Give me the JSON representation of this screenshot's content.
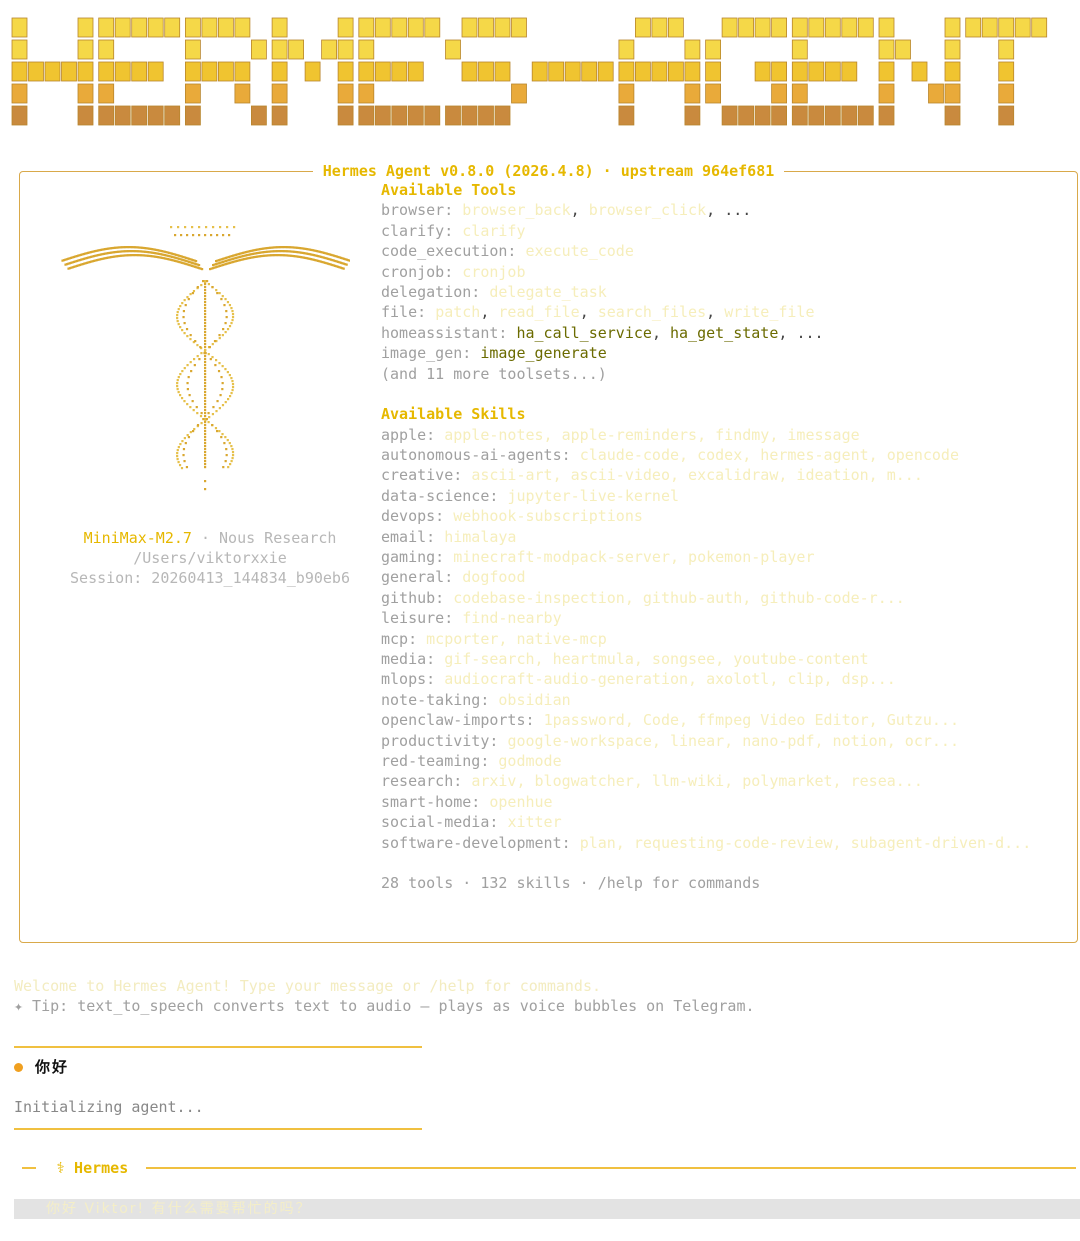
{
  "banner": {
    "text": "HERMES-AGENT",
    "colors": [
      "#f5d848",
      "#f0c430",
      "#e9aa3a",
      "#c98a3e"
    ]
  },
  "panel": {
    "title": "Hermes Agent v0.8.0 (2026.4.8) · upstream 964ef681",
    "border_color": "#d9a94a",
    "left": {
      "logo_icon": "caduceus-ascii-icon",
      "model": "MiniMax-M2.7",
      "provider": " · Nous Research",
      "path": "/Users/viktorxxie",
      "session": "Session: 20260413_144834_b90eb6"
    },
    "tools": {
      "heading": "Available Tools",
      "rows": [
        {
          "key": "browser: ",
          "value": "browser_back, browser_click, ..."
        },
        {
          "key": "clarify: ",
          "value": "clarify"
        },
        {
          "key": "code_execution: ",
          "value": "execute_code"
        },
        {
          "key": "cronjob: ",
          "value": "cronjob"
        },
        {
          "key": "delegation: ",
          "value": "delegate_task"
        },
        {
          "key": "file: ",
          "value": "patch, read_file, search_files, write_file"
        },
        {
          "key": "homeassistant: ",
          "value": "ha_call_service, ha_get_state, ..."
        },
        {
          "key": "image_gen: ",
          "value": "image_generate"
        }
      ],
      "more": "(and 11 more toolsets...)"
    },
    "skills": {
      "heading": "Available Skills",
      "rows": [
        {
          "key": "apple: ",
          "value": "apple-notes, apple-reminders, findmy, imessage"
        },
        {
          "key": "autonomous-ai-agents: ",
          "value": "claude-code, codex, hermes-agent, opencode"
        },
        {
          "key": "creative: ",
          "value": "ascii-art, ascii-video, excalidraw, ideation, m..."
        },
        {
          "key": "data-science: ",
          "value": "jupyter-live-kernel"
        },
        {
          "key": "devops: ",
          "value": "webhook-subscriptions"
        },
        {
          "key": "email: ",
          "value": "himalaya"
        },
        {
          "key": "gaming: ",
          "value": "minecraft-modpack-server, pokemon-player"
        },
        {
          "key": "general: ",
          "value": "dogfood"
        },
        {
          "key": "github: ",
          "value": "codebase-inspection, github-auth, github-code-r..."
        },
        {
          "key": "leisure: ",
          "value": "find-nearby"
        },
        {
          "key": "mcp: ",
          "value": "mcporter, native-mcp"
        },
        {
          "key": "media: ",
          "value": "gif-search, heartmula, songsee, youtube-content"
        },
        {
          "key": "mlops: ",
          "value": "audiocraft-audio-generation, axolotl, clip, dsp..."
        },
        {
          "key": "note-taking: ",
          "value": "obsidian"
        },
        {
          "key": "openclaw-imports: ",
          "value": "1password, Code, ffmpeg Video Editor, Gutzu..."
        },
        {
          "key": "productivity: ",
          "value": "google-workspace, linear, nano-pdf, notion, ocr..."
        },
        {
          "key": "red-teaming: ",
          "value": "godmode"
        },
        {
          "key": "research: ",
          "value": "arxiv, blogwatcher, llm-wiki, polymarket, resea..."
        },
        {
          "key": "smart-home: ",
          "value": "openhue"
        },
        {
          "key": "social-media: ",
          "value": "xitter"
        },
        {
          "key": "software-development: ",
          "value": "plan, requesting-code-review, subagent-driven-d..."
        }
      ]
    },
    "footer": "28 tools · 132 skills · /help for commands"
  },
  "welcome": "Welcome to Hermes Agent! Type your message or /help for commands.",
  "tip": "✦ Tip: text_to_speech converts text to audio — plays as voice bubbles on Telegram.",
  "user_message": "你好",
  "status": "Initializing agent...",
  "hermes_label": "⚕ Hermes",
  "reply": "你好 Viktor! 有什么需要帮忙的吗？",
  "colors": {
    "accent": "#e6b800",
    "border": "#d9a94a",
    "rule": "#f0c040",
    "user_dot": "#f0a020"
  }
}
